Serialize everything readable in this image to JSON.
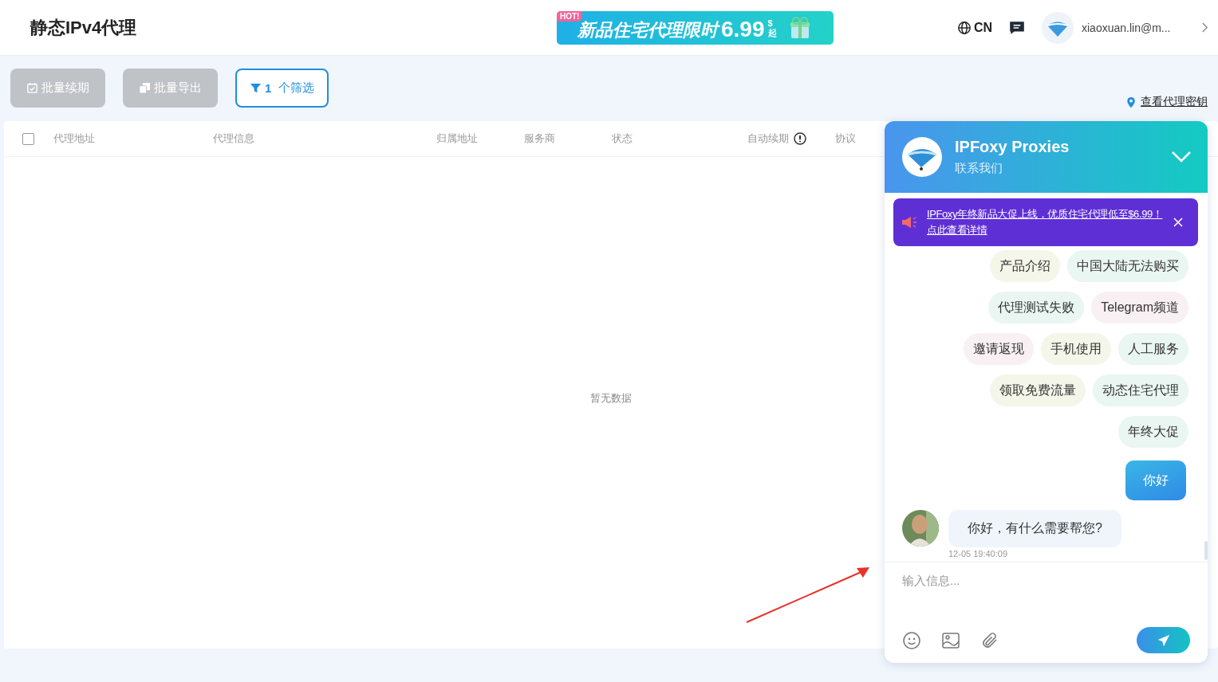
{
  "header": {
    "title": "静态IPv4代理",
    "banner": {
      "badge": "HOT!",
      "text": "新品住宅代理限时",
      "price": "6.99",
      "currency": "$",
      "suffix": "起"
    },
    "language": "CN",
    "user": "xiaoxuan.lin@m..."
  },
  "toolbar": {
    "buttons": [
      {
        "label": "批量续期",
        "disabled": true
      },
      {
        "label": "批量导出",
        "disabled": true
      }
    ],
    "filter": {
      "count": "1",
      "label": "个筛选"
    },
    "key_link": "查看代理密钥"
  },
  "table": {
    "checked": false,
    "columns": [
      "代理地址",
      "代理信息",
      "归属地址",
      "服务商",
      "状态",
      "自动续期",
      "协议"
    ],
    "empty": "暂无数据"
  },
  "chat": {
    "title": "IPFoxy Proxies",
    "subtitle": "联系我们",
    "notice": {
      "text": "IPFoxy年终新品大促上线，优质住宅代理低至$6.99！",
      "link": "点此查看详情"
    },
    "quick_replies": [
      [
        "产品介绍",
        "中国大陆无法购买"
      ],
      [
        "代理测试失败",
        "Telegram频道"
      ],
      [
        "邀请返现",
        "手机使用",
        "人工服务"
      ],
      [
        "领取免费流量",
        "动态住宅代理"
      ],
      [
        "年终大促"
      ]
    ],
    "messages": [
      {
        "kind": "sent",
        "text": "你好"
      },
      {
        "kind": "received",
        "text": "你好，有什么需要帮您?",
        "time": "12-05 19:40:09"
      }
    ],
    "placeholder": "输入信息..."
  }
}
